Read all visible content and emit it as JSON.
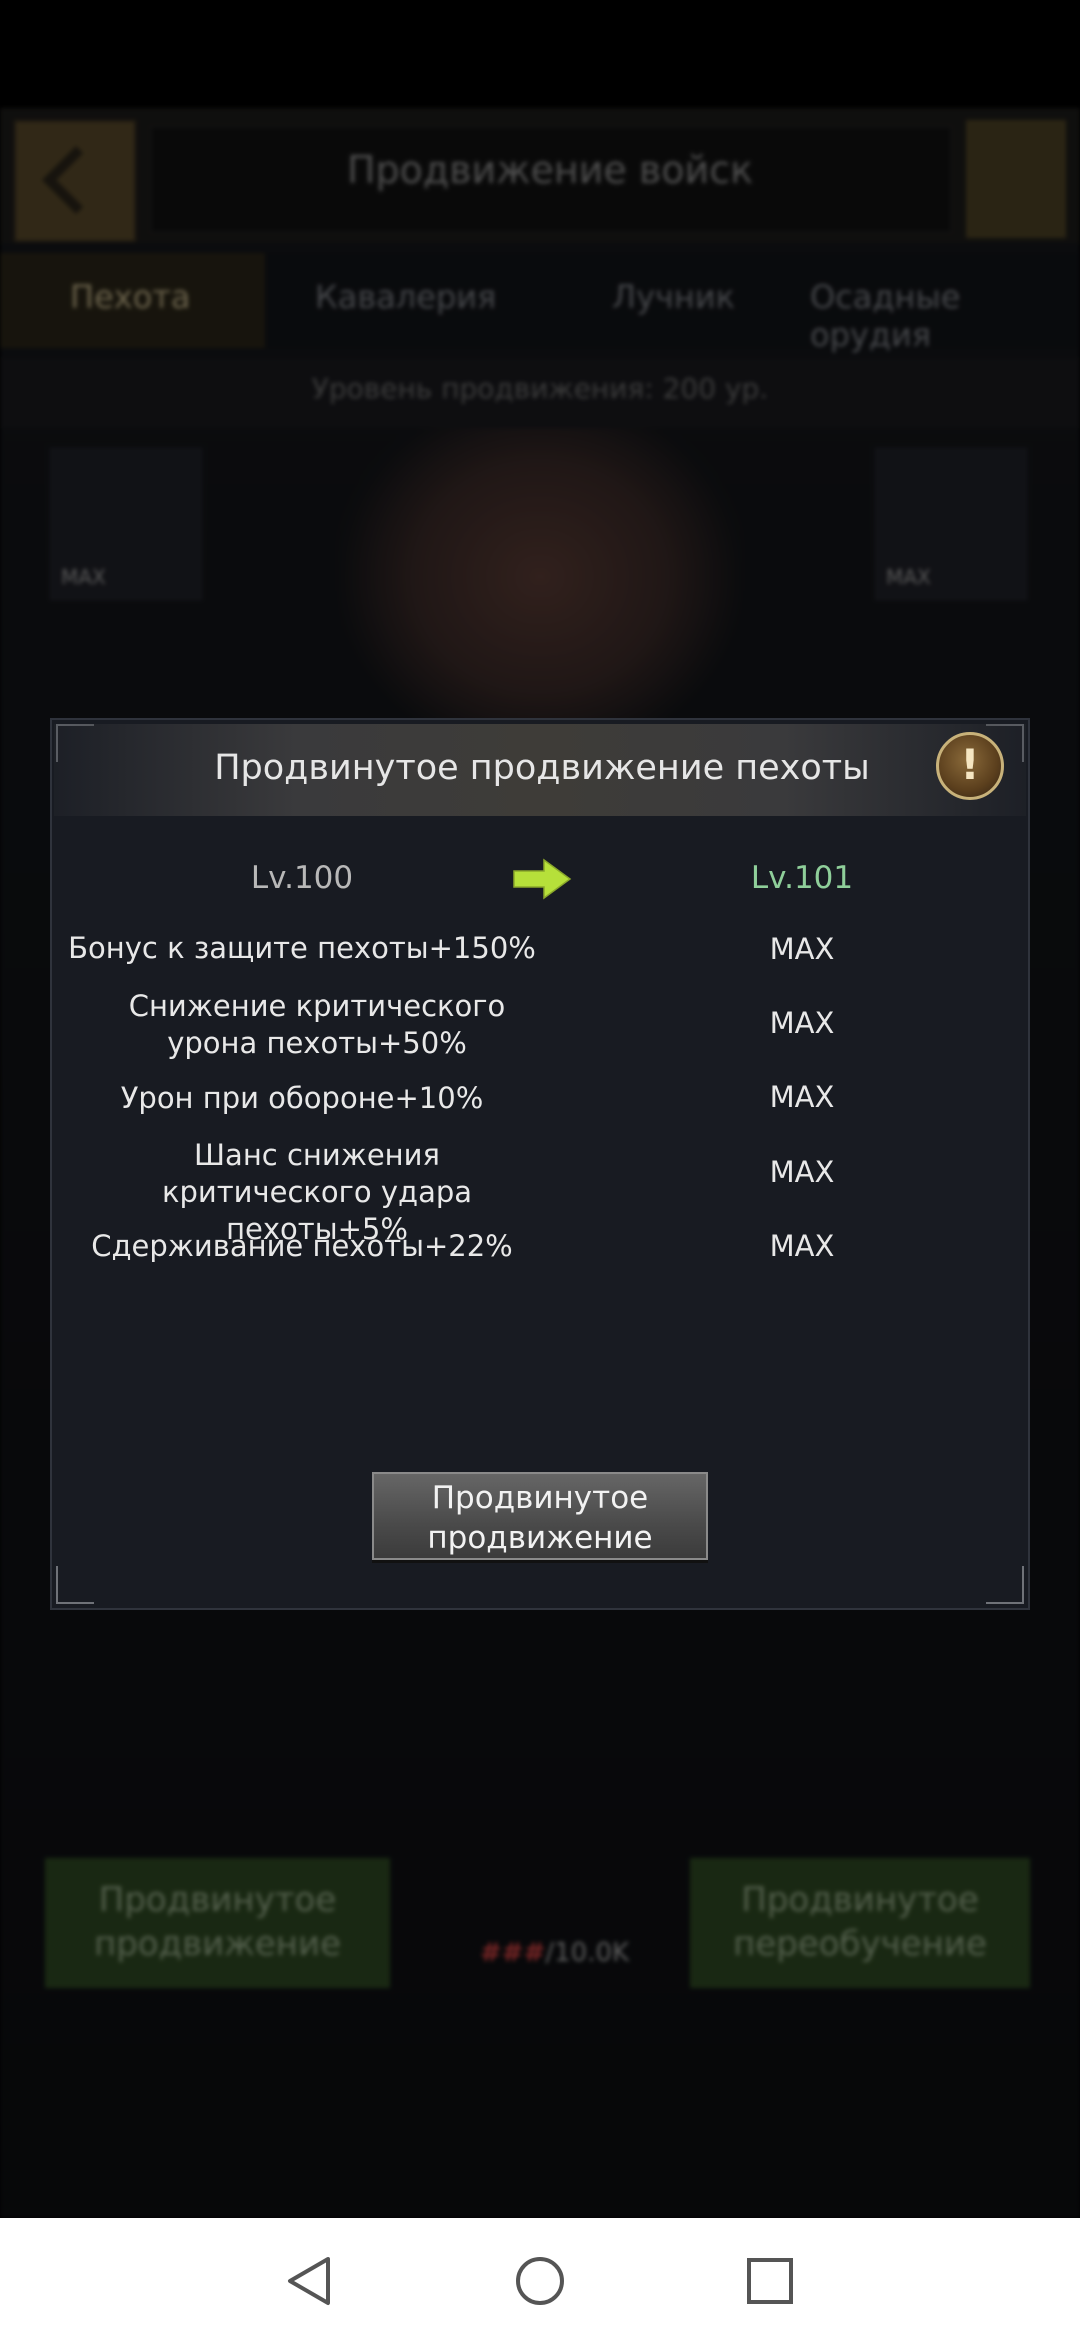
{
  "background": {
    "title": "Продвижение войск",
    "tabs": [
      "Пехота",
      "Кавалерия",
      "Лучник",
      "Осадные орудия"
    ],
    "sub_text": "Уровень продвижения: 200 ур.",
    "slot_label": "MAX",
    "left_button": "Продвинутое продвижение",
    "right_button": "Продвинутое переобучение",
    "cost_have": "###",
    "cost_need": "/10.0K"
  },
  "modal": {
    "title": "Продвинутое продвижение пехоты",
    "info_icon": "!",
    "level_current": "Lv.100",
    "level_next": "Lv.101",
    "stats": [
      {
        "label": "Бонус к защите пехоты+150%",
        "value": "MAX"
      },
      {
        "label": "Снижение критического урона пехоты+50%",
        "value": "MAX"
      },
      {
        "label": "Урон при обороне+10%",
        "value": "MAX"
      },
      {
        "label": "Шанс снижения критического удара пехоты+5%",
        "value": "MAX"
      },
      {
        "label": "Сдерживание пехоты+22%",
        "value": "MAX"
      }
    ],
    "button_label": "Продвинутое продвижение"
  },
  "colors": {
    "level_next": "#8fcf9a",
    "arrow": "#b6e03a",
    "modal_bg": "#181b22"
  }
}
